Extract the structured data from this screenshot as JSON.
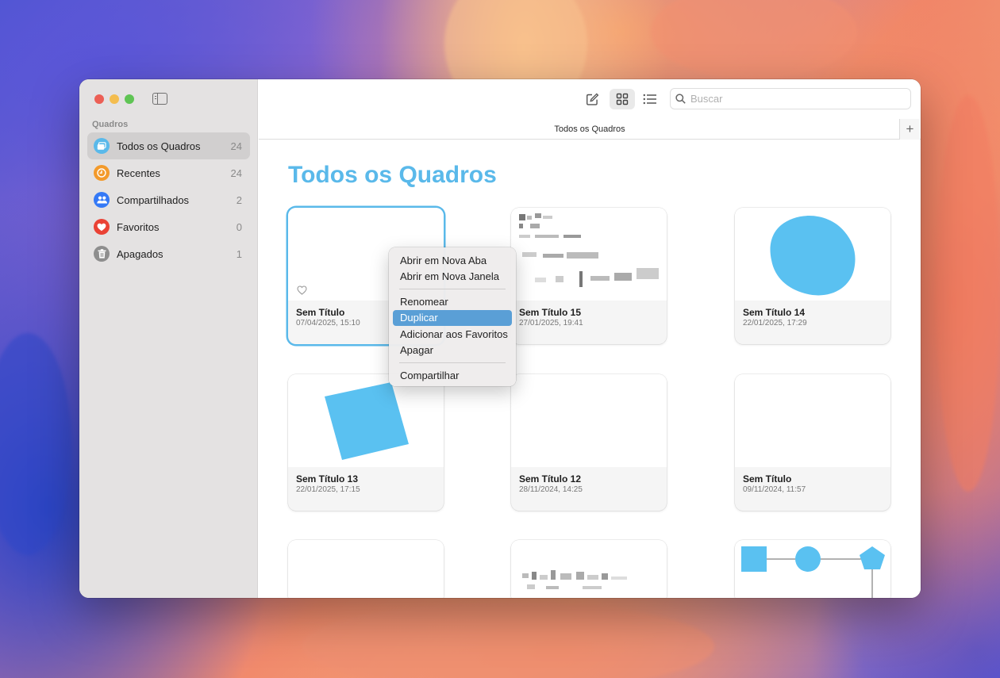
{
  "sidebar": {
    "section_title": "Quadros",
    "items": [
      {
        "label": "Todos os Quadros",
        "count": "24",
        "icon": "boards-icon",
        "color": "#5ab9ea",
        "active": true
      },
      {
        "label": "Recentes",
        "count": "24",
        "icon": "clock-icon",
        "color": "#f39a2b",
        "active": false
      },
      {
        "label": "Compartilhados",
        "count": "2",
        "icon": "people-icon",
        "color": "#3479f6",
        "active": false
      },
      {
        "label": "Favoritos",
        "count": "0",
        "icon": "heart-icon",
        "color": "#ea4235",
        "active": false
      },
      {
        "label": "Apagados",
        "count": "1",
        "icon": "trash-icon",
        "color": "#8e8e8e",
        "active": false
      }
    ]
  },
  "toolbar": {
    "new_board_icon": "compose-icon",
    "grid_view_icon": "grid-icon",
    "list_view_icon": "list-icon",
    "search_placeholder": "Buscar"
  },
  "tabbar": {
    "tab_label": "Todos os Quadros",
    "add_label": "+"
  },
  "main": {
    "title": "Todos os Quadros",
    "accent_color": "#5ab9ea"
  },
  "boards": [
    {
      "title": "Sem Título",
      "date": "07/04/2025, 15:10",
      "thumb": "empty",
      "selected": true
    },
    {
      "title": "Sem Título 15",
      "date": "27/01/2025, 19:41",
      "thumb": "pixelated-text"
    },
    {
      "title": "Sem Título 14",
      "date": "22/01/2025, 17:29",
      "thumb": "blue-squircle"
    },
    {
      "title": "Sem Título 13",
      "date": "22/01/2025, 17:15",
      "thumb": "blue-rotated-square"
    },
    {
      "title": "Sem Título 12",
      "date": "28/11/2024, 14:25",
      "thumb": "empty"
    },
    {
      "title": "Sem Título",
      "date": "09/11/2024, 11:57",
      "thumb": "empty"
    },
    {
      "title": "",
      "date": "",
      "thumb": "empty"
    },
    {
      "title": "",
      "date": "",
      "thumb": "pixelated-text"
    },
    {
      "title": "",
      "date": "",
      "thumb": "shape-diagram"
    }
  ],
  "context_menu": {
    "groups": [
      [
        "Abrir em Nova Aba",
        "Abrir em Nova Janela"
      ],
      [
        "Renomear",
        "Duplicar",
        "Adicionar aos Favoritos",
        "Apagar"
      ],
      [
        "Compartilhar"
      ]
    ],
    "highlighted": "Duplicar"
  }
}
